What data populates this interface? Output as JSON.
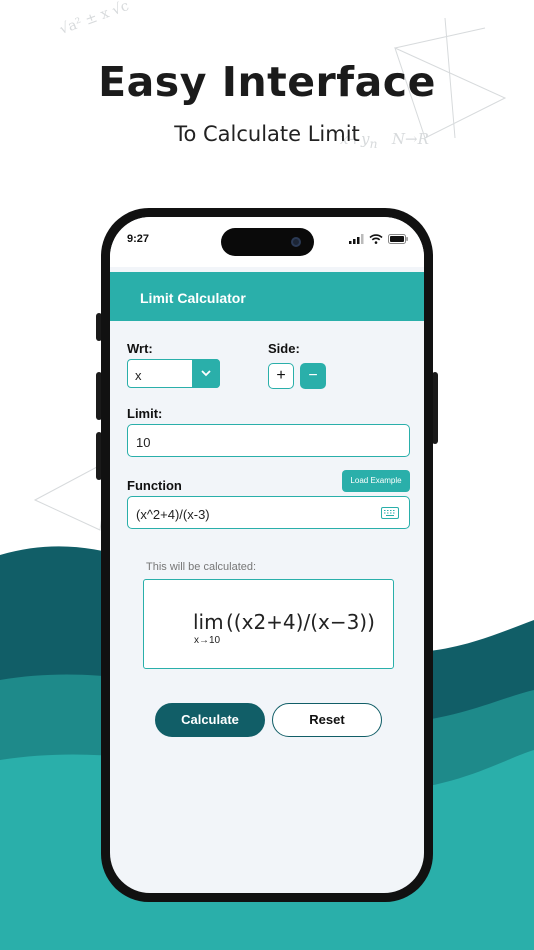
{
  "promo": {
    "headline": "Easy Interface",
    "subheadline": "To Calculate Limit"
  },
  "status_bar": {
    "time": "9:27"
  },
  "app": {
    "title": "Limit Calculator",
    "wrt": {
      "label": "Wrt:",
      "value": "x"
    },
    "side": {
      "label": "Side:",
      "plus": "+",
      "minus": "−"
    },
    "limit": {
      "label": "Limit:",
      "value": "10"
    },
    "function": {
      "label": "Function",
      "load_example": "Load Example",
      "value": "(x^2+4)/(x-3)"
    },
    "preview": {
      "note": "This will be calculated:",
      "lim": "lim",
      "approach": "x→10",
      "expression": "((x2+4)/(x−3))"
    },
    "actions": {
      "calculate": "Calculate",
      "reset": "Reset"
    }
  },
  "colors": {
    "teal": "#2aafaa",
    "dark_teal": "#115e67",
    "wave_dark": "#115e67",
    "wave_mid": "#1e8a8a",
    "wave_light": "#2aafaa"
  },
  "icons": [
    "chevron-down-icon",
    "keyboard-icon",
    "signal-icon",
    "wifi-icon",
    "battery-icon",
    "camera-icon"
  ]
}
